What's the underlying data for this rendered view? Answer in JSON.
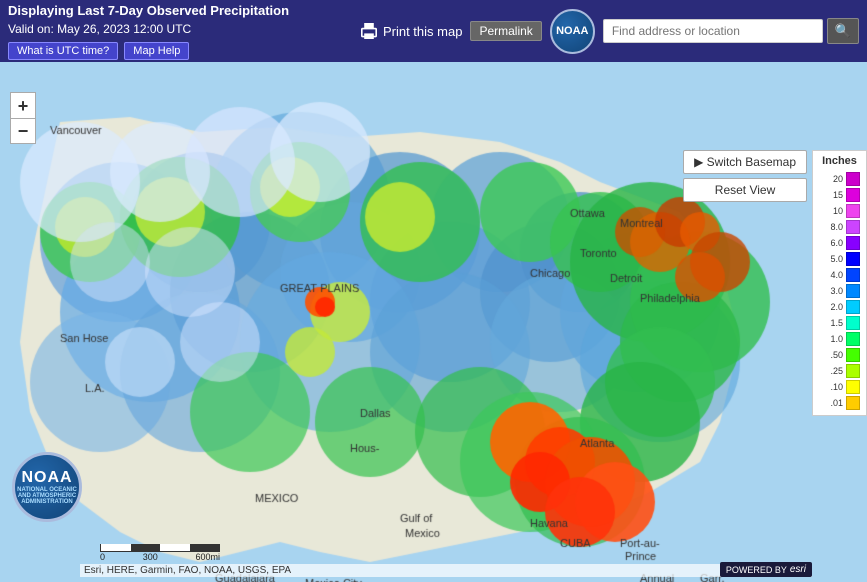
{
  "header": {
    "title": "Displaying Last 7-Day Observed Precipitation",
    "subtitle": "Valid on: May 26, 2023 12:00 UTC",
    "print_label": "Print this map",
    "permalink_label": "Permalink",
    "utc_btn_label": "What is UTC time?",
    "map_help_label": "Map Help",
    "search_placeholder": "Find address or location",
    "noaa_alt": "NOAA Climate.gov"
  },
  "map_controls": {
    "zoom_in": "+",
    "zoom_out": "−",
    "switch_basemap": "▶ Switch Basemap",
    "reset_view": "Reset View"
  },
  "legend": {
    "title": "Inches",
    "items": [
      {
        "label": "20",
        "color": "#cc00cc"
      },
      {
        "label": "15",
        "color": "#dd00dd"
      },
      {
        "label": "10",
        "color": "#ee44ee"
      },
      {
        "label": "8.0",
        "color": "#cc44ff"
      },
      {
        "label": "6.0",
        "color": "#8800ff"
      },
      {
        "label": "5.0",
        "color": "#0000ff"
      },
      {
        "label": "4.0",
        "color": "#0044ff"
      },
      {
        "label": "3.0",
        "color": "#0088ff"
      },
      {
        "label": "2.0",
        "color": "#00ccff"
      },
      {
        "label": "1.5",
        "color": "#00ffcc"
      },
      {
        "label": "1.0",
        "color": "#00ff66"
      },
      {
        "label": ".50",
        "color": "#44ff00"
      },
      {
        "label": ".25",
        "color": "#aaff00"
      },
      {
        "label": ".10",
        "color": "#ffff00"
      },
      {
        "label": ".01",
        "color": "#ffcc00"
      }
    ]
  },
  "scale": {
    "labels": [
      "0",
      "300",
      "600mi"
    ]
  },
  "attribution": {
    "text": "Esri, HERE, Garmin, FAO, NOAA, USGS, EPA"
  },
  "esri": {
    "label": "POWERED BY",
    "brand": "esri"
  }
}
